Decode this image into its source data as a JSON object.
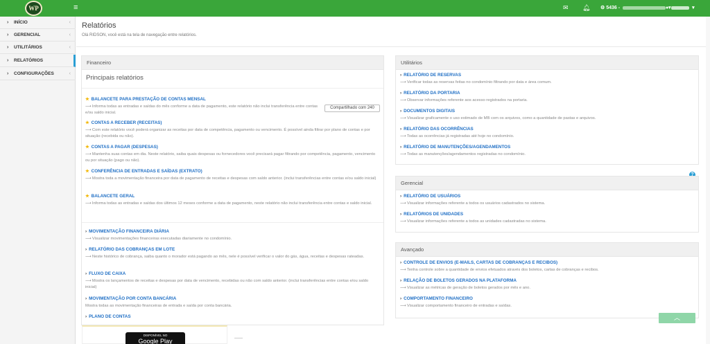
{
  "topbar": {
    "logo_text": "WP",
    "account_number": "5436 -",
    "user_name": "",
    "accent_color": "#3aa63a",
    "icons": [
      "menu-icon",
      "mail-icon",
      "bell-icon",
      "gear-icon",
      "user-icon"
    ]
  },
  "sidebar": {
    "items": [
      {
        "label": "INÍCIO"
      },
      {
        "label": "GERENCIAL"
      },
      {
        "label": "UTILITÁRIOS"
      },
      {
        "label": "RELATÓRIOS"
      },
      {
        "label": "CONFIGURAÇÕES"
      }
    ]
  },
  "page": {
    "title": "Relatórios",
    "subtitle": "Olá RIDSON, você está na tela de navegação entre relatórios."
  },
  "financeiro": {
    "header": "Financeiro",
    "section_title": "Principais relatórios",
    "share_label": "Compartilhado com 240",
    "main": [
      {
        "title": "BALANCETE PARA PRESTAÇÃO DE CONTAS MENSAL",
        "desc": "Informa todas as entradas e saídas do mês conforme a data de pagamento, este relatório não inclui transferência entre contas e/ou saldo inicial."
      },
      {
        "title": "CONTAS A RECEBER (RECEITAS)",
        "desc": "Com este relatório você poderá organizar as receitas por data de competência, pagamento ou vencimento. É possível ainda filtrar por plano de contas e por situação (recebida ou não)."
      },
      {
        "title": "CONTAS A PAGAR (DESPESAS)",
        "desc": "Mantenha suas contas em dia. Neste relatório, saiba quais despesas ou fornecedores você precisará pagar filtrando por competência, pagamento, vencimento ou por situação (pago ou não)."
      },
      {
        "title": "CONFERÊNCIA DE ENTRADAS E SAÍDAS (EXTRATO)",
        "desc": "Mostra toda a movimentação financeira por data de pagamento de receitas e despesas com saldo anterior. (inclui transferências entre contas e/ou saldo inicial)"
      },
      {
        "title": "BALANCETE GERAL",
        "desc": "Informa todas as entradas e saídas dos últimos 12 meses conforme a data de pagamento, neste relatório não inclui transferência entre contas e saldo inicial."
      }
    ],
    "others": [
      {
        "title": "MOVIMENTAÇÃO FINANCEIRA DIÁRIA",
        "desc": "Visualizar movimentações financeiras executadas diariamente no condomínio."
      },
      {
        "title": "RELATÓRIO DAS COBRANÇAS EM LOTE",
        "desc": "Neste histórico de cobrança, saiba quanto o morador está pagando ao mês, nele é possível verificar o valor do gás, água, receitas e despesas rateadas."
      },
      {
        "title": "FLUXO DE CAIXA",
        "desc": "Mostra os lançamentos de receitas e despesas por data de vencimento, recebidas ou não com saldo anterior. (inclui transferências entre contas e/ou saldo inicial)"
      },
      {
        "title": "MOVIMENTAÇÃO POR CONTA BANCÁRIA",
        "desc": "Mostra todas as movimentação financeiras de entrada e saída por conta bancária."
      },
      {
        "title": "PLANO DE CONTAS",
        "desc": ""
      }
    ]
  },
  "utilitarios": {
    "header": "Utilitários",
    "items": [
      {
        "title": "RELATÓRIO DE RESERVAS",
        "desc": "Verificar todas as reservas feitas no condomínio filtrando por data e área comum."
      },
      {
        "title": "RELATÓRIO DA PORTARIA",
        "desc": "Observar informações referente aos acesso registrados na portaria."
      },
      {
        "title": "DOCUMENTOS DIGITAIS",
        "desc": "Visualizar graficamente o uso estimado de MB com os arquivos, como a quantidade de pastas e arquivos."
      },
      {
        "title": "RELATÓRIO DAS OCORRÊNCIAS",
        "desc": "Todas as ocorrências já registradas até hoje no condomínio."
      },
      {
        "title": "RELATÓRIO DE MANUTENÇÕES/AGENDAMENTOS",
        "desc": "Todas as manutenções/agendamentos registradas no condomínio."
      }
    ]
  },
  "gerencial": {
    "header": "Gerencial",
    "items": [
      {
        "title": "RELATÓRIO DE USUÁRIOS",
        "desc": "Visualizar informações referente a todos os usuários cadastrados no sistema."
      },
      {
        "title": "RELATÓRIOS DE UNIDADES",
        "desc": "Visualizar informações referente a todos as unidades cadastradas no sistema."
      }
    ]
  },
  "avancado": {
    "header": "Avançado",
    "items": [
      {
        "title": "CONTROLE DE ENVIOS (E-MAILS, CARTAS DE COBRANÇAS E RECIBOS)",
        "desc": "Tenha controle sobre a quantidade de envios efetuados através dos boletos, cartas de cobranças e recibos."
      },
      {
        "title": "RELAÇÃO DE BOLETOS GERADOS NA PLATAFORMA",
        "desc": "Visualizar as métricas de geração de boletos gerados por mês e ano."
      },
      {
        "title": "COMPORTAMENTO FINANCEIRO",
        "desc": "Visualizar comportamento financeiro de entradas e saídas."
      }
    ]
  },
  "footer": {
    "gplay_small": "DISPONÍVEL NO",
    "gplay_big": "Google Play",
    "help_glyph": "?",
    "back_top_glyph": "︿"
  }
}
